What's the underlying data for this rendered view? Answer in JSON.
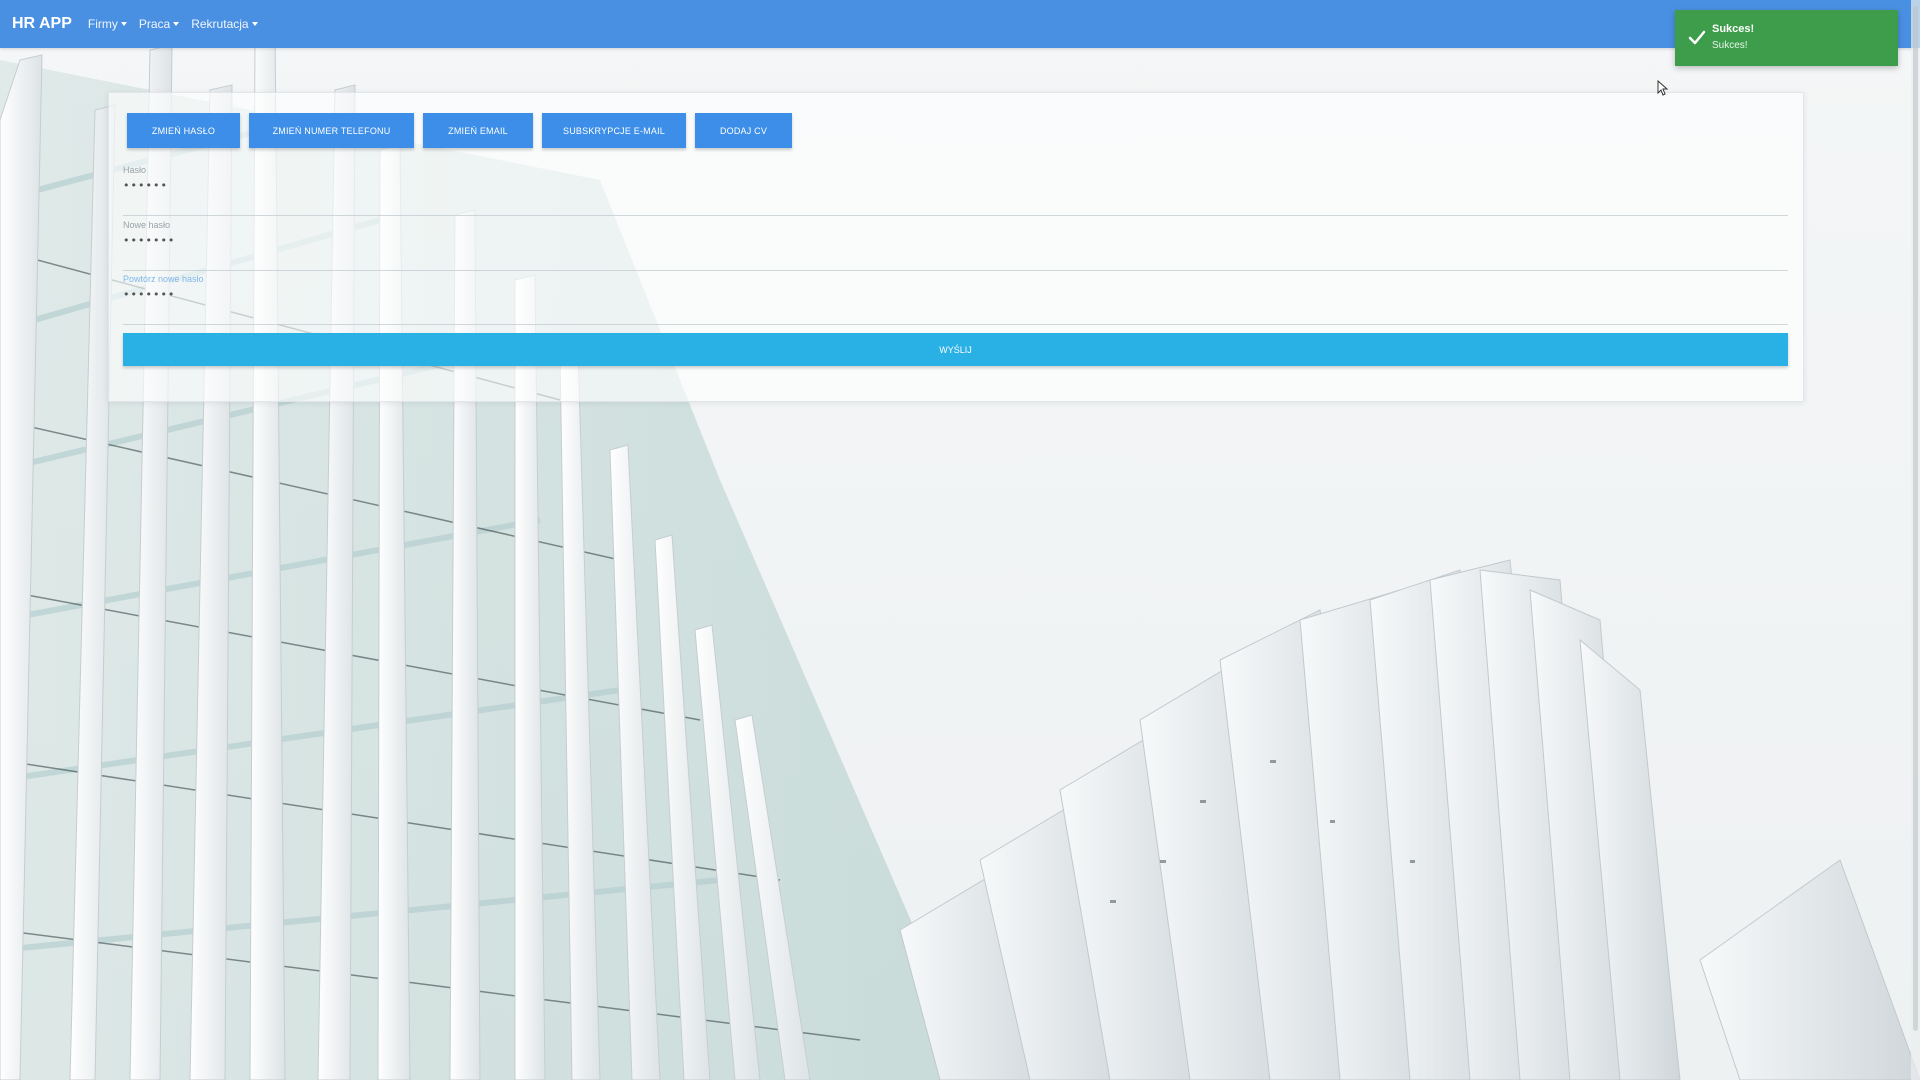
{
  "navbar": {
    "brand": "HR APP",
    "items": [
      {
        "label": "Firmy"
      },
      {
        "label": "Praca"
      },
      {
        "label": "Rekrutacja"
      }
    ]
  },
  "tabs": [
    {
      "label": "ZMIEŃ HASŁO"
    },
    {
      "label": "ZMIEŃ NUMER TELEFONU"
    },
    {
      "label": "ZMIEŃ EMAIL"
    },
    {
      "label": "SUBSKRYPCJE E-MAIL"
    },
    {
      "label": "DODAJ CV"
    }
  ],
  "form": {
    "fields": [
      {
        "label": "Hasło",
        "value": "••••••"
      },
      {
        "label": "Nowe hasło",
        "value": "•••••••"
      },
      {
        "label": "Powtórz nowe hasło",
        "value": "•••••••"
      }
    ],
    "submit_label": "WYŚLIJ"
  },
  "toast": {
    "title": "Sukces!",
    "message": "Sukces!"
  },
  "colors": {
    "navbar": "#4a90e2",
    "tab_button": "#3d8ee8",
    "submit_button": "#29b0e4",
    "toast": "#3d9d4a"
  }
}
